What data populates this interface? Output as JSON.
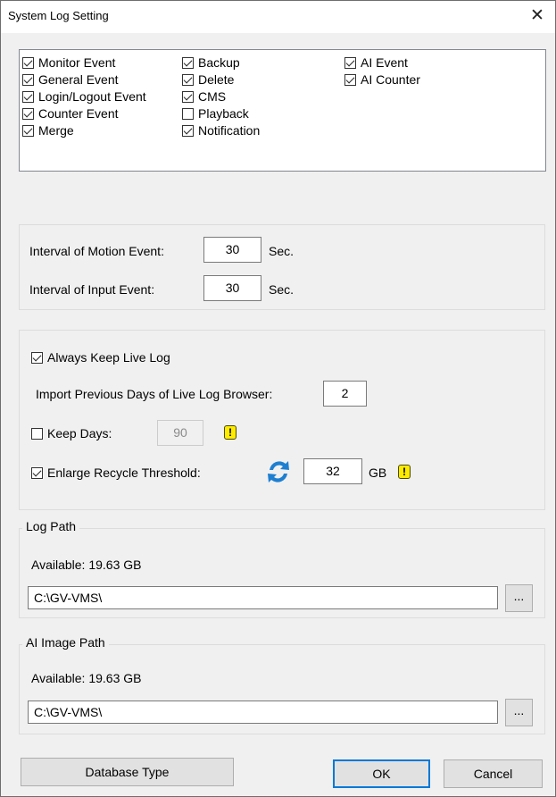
{
  "window": {
    "title": "System Log Setting",
    "close_icon": "close-icon"
  },
  "events": {
    "col1": [
      {
        "label": "Monitor Event",
        "checked": true
      },
      {
        "label": "General Event",
        "checked": true
      },
      {
        "label": "Login/Logout Event",
        "checked": true
      },
      {
        "label": "Counter Event",
        "checked": true
      },
      {
        "label": "Merge",
        "checked": true
      }
    ],
    "col2": [
      {
        "label": "Backup",
        "checked": true
      },
      {
        "label": "Delete",
        "checked": true
      },
      {
        "label": "CMS",
        "checked": true
      },
      {
        "label": "Playback",
        "checked": false
      },
      {
        "label": "Notification",
        "checked": true
      }
    ],
    "col3": [
      {
        "label": "AI Event",
        "checked": true
      },
      {
        "label": "AI Counter",
        "checked": true
      }
    ]
  },
  "intervals": {
    "motion_label": "Interval of Motion Event:",
    "motion_value": "30",
    "input_label": "Interval of Input Event:",
    "input_value": "30",
    "unit": "Sec."
  },
  "live_log": {
    "always_keep_label": "Always Keep Live Log",
    "always_keep_checked": true,
    "import_label": "Import Previous Days of Live Log Browser:",
    "import_value": "2",
    "keep_days_label": "Keep Days:",
    "keep_days_checked": false,
    "keep_days_value": "90",
    "enlarge_label": "Enlarge Recycle Threshold:",
    "enlarge_checked": true,
    "enlarge_value": "32",
    "enlarge_unit": "GB",
    "warn_glyph": "!"
  },
  "log_path": {
    "title": "Log Path",
    "available": "Available: 19.63 GB",
    "path": "C:\\GV-VMS\\",
    "browse_label": "..."
  },
  "ai_image_path": {
    "title": "AI Image Path",
    "available": "Available: 19.63 GB",
    "path": "C:\\GV-VMS\\",
    "browse_label": "..."
  },
  "buttons": {
    "database_type": "Database Type",
    "ok": "OK",
    "cancel": "Cancel"
  },
  "colors": {
    "accent": "#0078d7",
    "warning": "#ffeb00",
    "refresh_blue": "#1e7fd1"
  }
}
